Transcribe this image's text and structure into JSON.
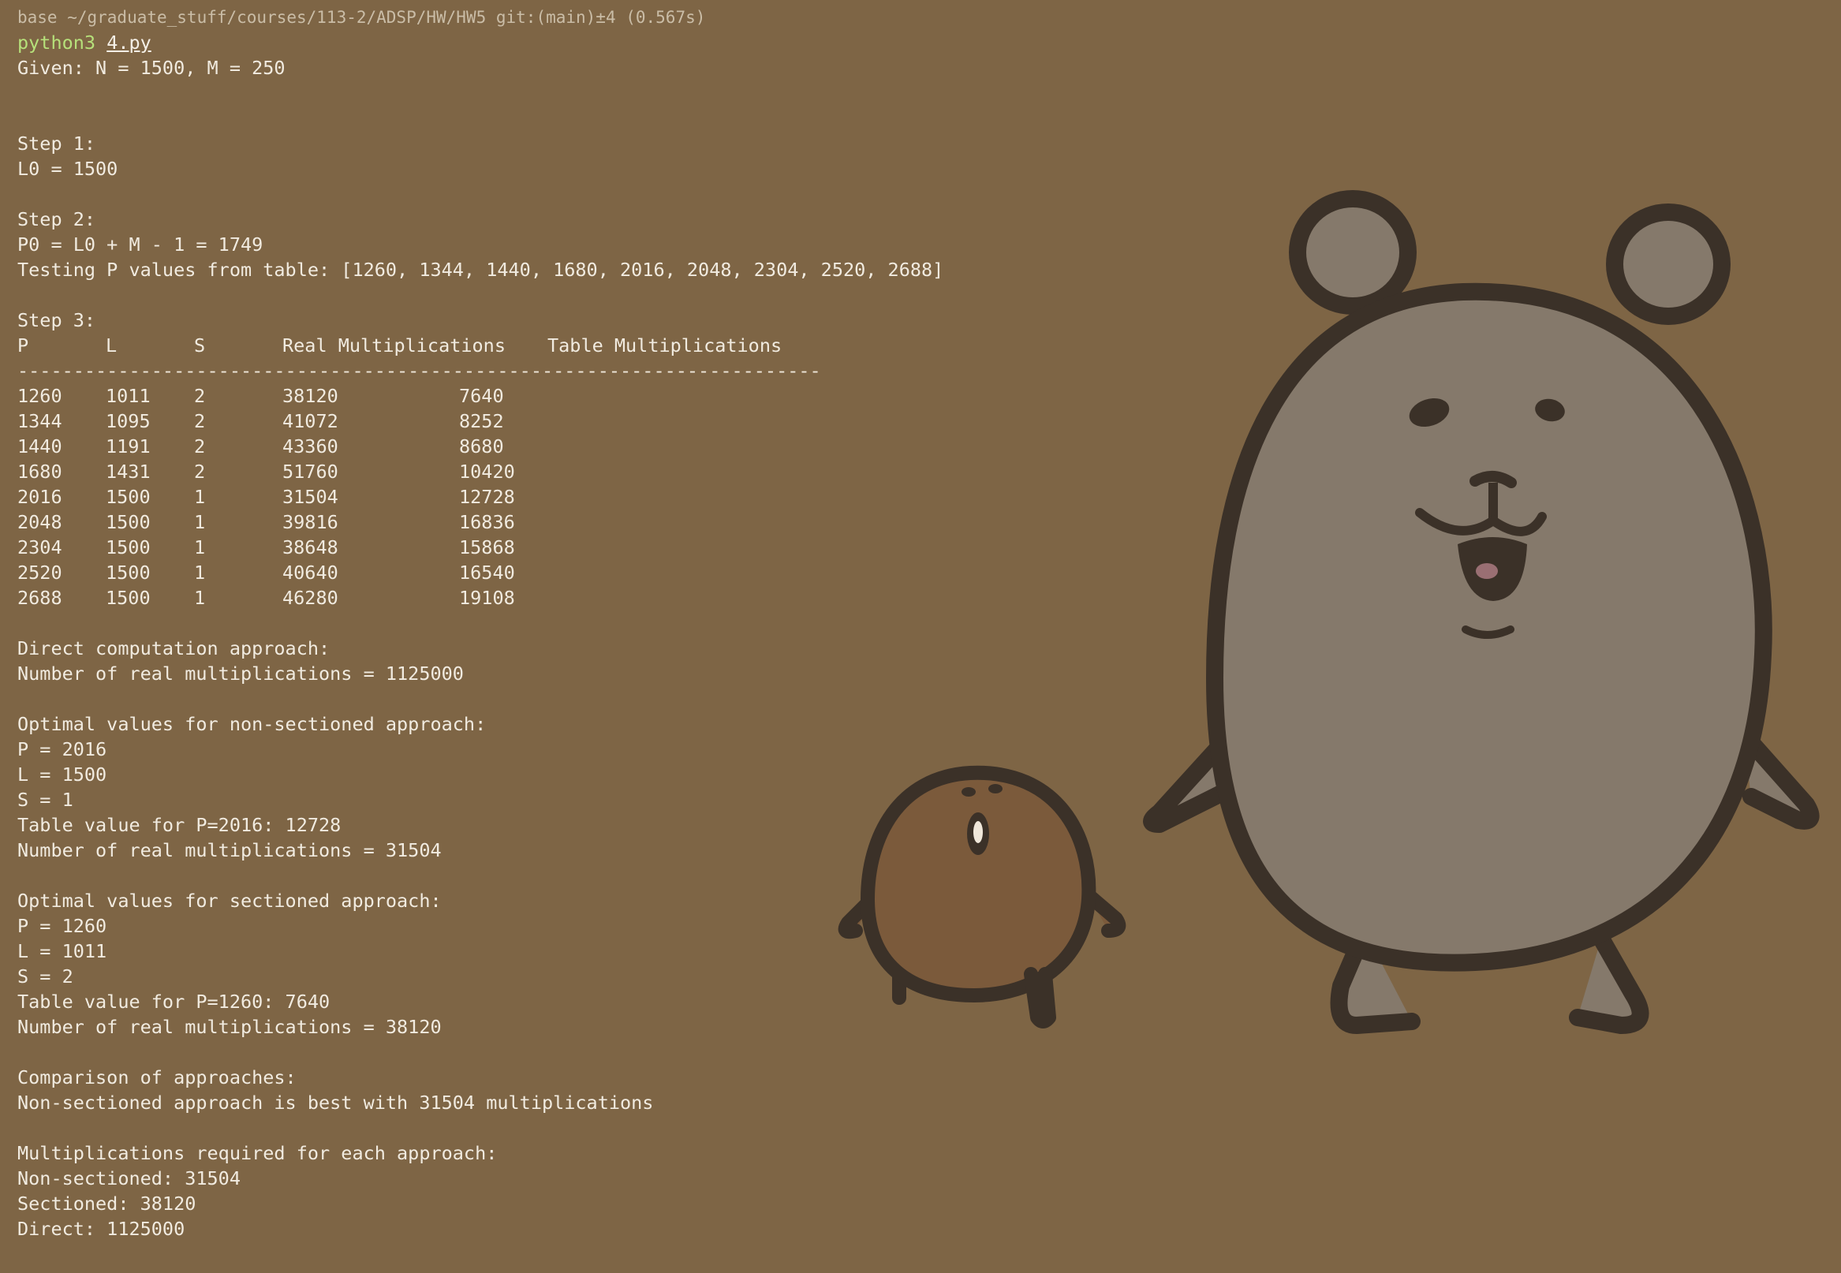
{
  "prompt": {
    "info": "base ~/graduate_stuff/courses/113-2/ADSP/HW/HW5 git:(main)±4 (0.567s)"
  },
  "command": {
    "program": "python3",
    "arg": "4.py"
  },
  "output": {
    "given": "Given: N = 1500, M = 250",
    "step1_title": "Step 1:",
    "step1_l0": "L0 = 1500",
    "step2_title": "Step 2:",
    "step2_p0": "P0 = L0 + M - 1 = 1749",
    "step2_testing": "Testing P values from table: [1260, 1344, 1440, 1680, 2016, 2048, 2304, 2520, 2688]",
    "step3_title": "Step 3:",
    "table": {
      "headers": [
        "P",
        "L",
        "S",
        "Real Multiplications",
        "Table Multiplications"
      ],
      "separator": "------------------------------------------------------------------------",
      "rows": [
        [
          "1260",
          "1011",
          "2",
          "38120",
          "7640"
        ],
        [
          "1344",
          "1095",
          "2",
          "41072",
          "8252"
        ],
        [
          "1440",
          "1191",
          "2",
          "43360",
          "8680"
        ],
        [
          "1680",
          "1431",
          "2",
          "51760",
          "10420"
        ],
        [
          "2016",
          "1500",
          "1",
          "31504",
          "12728"
        ],
        [
          "2048",
          "1500",
          "1",
          "39816",
          "16836"
        ],
        [
          "2304",
          "1500",
          "1",
          "38648",
          "15868"
        ],
        [
          "2520",
          "1500",
          "1",
          "40640",
          "16540"
        ],
        [
          "2688",
          "1500",
          "1",
          "46280",
          "19108"
        ]
      ]
    },
    "direct_title": "Direct computation approach:",
    "direct_result": "Number of real multiplications = 1125000",
    "nonsec_title": "Optimal values for non-sectioned approach:",
    "nonsec_p": "P = 2016",
    "nonsec_l": "L = 1500",
    "nonsec_s": "S = 1",
    "nonsec_table": "Table value for P=2016: 12728",
    "nonsec_result": "Number of real multiplications = 31504",
    "sec_title": "Optimal values for sectioned approach:",
    "sec_p": "P = 1260",
    "sec_l": "L = 1011",
    "sec_s": "S = 2",
    "sec_table": "Table value for P=1260: 7640",
    "sec_result": "Number of real multiplications = 38120",
    "comp_title": "Comparison of approaches:",
    "comp_result": "Non-sectioned approach is best with 31504 multiplications",
    "mult_title": "Multiplications required for each approach:",
    "mult_nonsec": "Non-sectioned: 31504",
    "mult_sec": "Sectioned: 38120",
    "mult_direct": "Direct: 1125000"
  },
  "colors": {
    "background": "#7e6545",
    "text": "#f1ebe0",
    "command": "#b6e07a",
    "prompt_info": "#cabda7"
  }
}
